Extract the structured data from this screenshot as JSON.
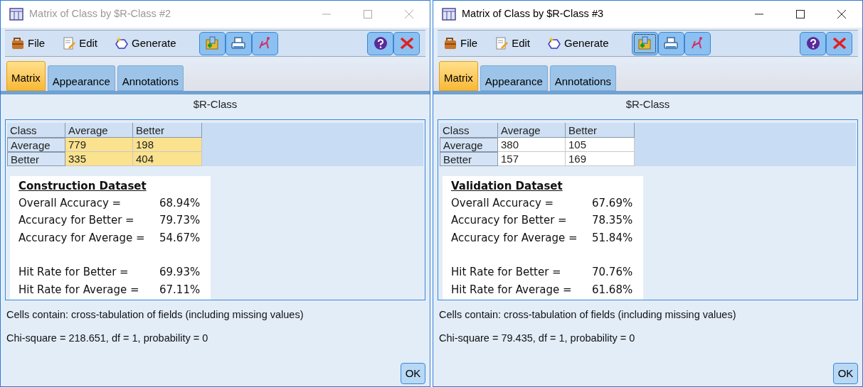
{
  "windows": [
    {
      "title": "Matrix of Class by $R-Class #2",
      "active": false,
      "menu": [
        "File",
        "Edit",
        "Generate"
      ],
      "tabs": [
        {
          "label": "Matrix",
          "selected": true
        },
        {
          "label": "Appearance",
          "selected": false
        },
        {
          "label": "Annotations",
          "selected": false
        }
      ],
      "matrix": {
        "header": "$R-Class",
        "corner": "Class",
        "columns": [
          "Average",
          "Better"
        ],
        "rows": [
          {
            "label": "Average",
            "cells": [
              {
                "value": "779",
                "selected": true
              },
              {
                "value": "198",
                "selected": true
              }
            ]
          },
          {
            "label": "Better",
            "cells": [
              {
                "value": "335",
                "selected": true
              },
              {
                "value": "404",
                "selected": true
              }
            ]
          }
        ]
      },
      "summary": {
        "title": "Construction Dataset",
        "accuracy": [
          {
            "label": "Overall Accuracy =",
            "value": "68.94%"
          },
          {
            "label": "Accuracy for Better =",
            "value": "79.73%"
          },
          {
            "label": "Accuracy for Average =",
            "value": "54.67%"
          }
        ],
        "hit_rates": [
          {
            "label": "Hit Rate for Better =",
            "value": "69.93%"
          },
          {
            "label": "Hit Rate for Average =",
            "value": "67.11%"
          }
        ]
      },
      "note": "Cells contain: cross-tabulation of fields (including missing values)",
      "chi_square": "Chi-square = 218.651, df = 1, probability = 0",
      "ok": "OK"
    },
    {
      "title": "Matrix of Class by $R-Class #3",
      "active": true,
      "menu": [
        "File",
        "Edit",
        "Generate"
      ],
      "tabs": [
        {
          "label": "Matrix",
          "selected": true
        },
        {
          "label": "Appearance",
          "selected": false
        },
        {
          "label": "Annotations",
          "selected": false
        }
      ],
      "matrix": {
        "header": "$R-Class",
        "corner": "Class",
        "columns": [
          "Average",
          "Better"
        ],
        "rows": [
          {
            "label": "Average",
            "cells": [
              {
                "value": "380",
                "selected": false
              },
              {
                "value": "105",
                "selected": false
              }
            ]
          },
          {
            "label": "Better",
            "cells": [
              {
                "value": "157",
                "selected": false
              },
              {
                "value": "169",
                "selected": false
              }
            ]
          }
        ]
      },
      "summary": {
        "title": "Validation Dataset",
        "accuracy": [
          {
            "label": "Overall Accuracy =",
            "value": "67.69%"
          },
          {
            "label": "Accuracy for Better =",
            "value": "78.35%"
          },
          {
            "label": "Accuracy for Average =",
            "value": "51.84%"
          }
        ],
        "hit_rates": [
          {
            "label": "Hit Rate for Better =",
            "value": "70.76%"
          },
          {
            "label": "Hit Rate for Average =",
            "value": "61.68%"
          }
        ]
      },
      "note": "Cells contain: cross-tabulation of fields (including missing values)",
      "chi_square": "Chi-square = 79.435, df = 1, probability = 0",
      "ok": "OK"
    }
  ]
}
